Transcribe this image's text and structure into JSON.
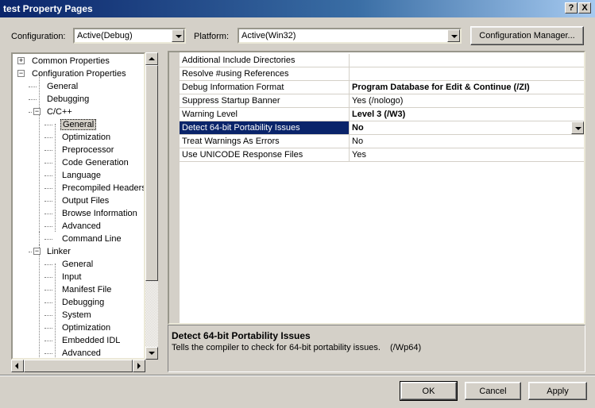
{
  "window": {
    "title": "test Property Pages",
    "help_glyph": "?",
    "close_glyph": "X"
  },
  "config": {
    "configuration_label": "Configuration:",
    "configuration_value": "Active(Debug)",
    "platform_label": "Platform:",
    "platform_value": "Active(Win32)",
    "manager_button": "Configuration Manager..."
  },
  "tree": {
    "items": [
      {
        "label": "Common Properties",
        "expander": "+"
      },
      {
        "label": "Configuration Properties",
        "expander": "−"
      },
      {
        "label": "General"
      },
      {
        "label": "Debugging"
      },
      {
        "label": "C/C++",
        "expander": "−"
      },
      {
        "label": "General",
        "selected": true
      },
      {
        "label": "Optimization"
      },
      {
        "label": "Preprocessor"
      },
      {
        "label": "Code Generation"
      },
      {
        "label": "Language"
      },
      {
        "label": "Precompiled Headers"
      },
      {
        "label": "Output Files"
      },
      {
        "label": "Browse Information"
      },
      {
        "label": "Advanced"
      },
      {
        "label": "Command Line"
      },
      {
        "label": "Linker",
        "expander": "−"
      },
      {
        "label": "General"
      },
      {
        "label": "Input"
      },
      {
        "label": "Manifest File"
      },
      {
        "label": "Debugging"
      },
      {
        "label": "System"
      },
      {
        "label": "Optimization"
      },
      {
        "label": "Embedded IDL"
      },
      {
        "label": "Advanced"
      }
    ]
  },
  "properties": {
    "rows": [
      {
        "name": "Additional Include Directories",
        "value": ""
      },
      {
        "name": "Resolve #using References",
        "value": ""
      },
      {
        "name": "Debug Information Format",
        "value": "Program Database for Edit & Continue (/ZI)",
        "bold": true
      },
      {
        "name": "Suppress Startup Banner",
        "value": "Yes (/nologo)"
      },
      {
        "name": "Warning Level",
        "value": "Level 3 (/W3)",
        "bold": true
      },
      {
        "name": "Detect 64-bit Portability Issues",
        "value": "No",
        "bold": true,
        "selected": true
      },
      {
        "name": "Treat Warnings As Errors",
        "value": "No"
      },
      {
        "name": "Use UNICODE Response Files",
        "value": "Yes"
      }
    ]
  },
  "description": {
    "title": "Detect 64-bit Portability Issues",
    "text": "Tells the compiler to check for 64-bit portability issues.",
    "flag": "(/Wp64)"
  },
  "buttons": {
    "ok": "OK",
    "cancel": "Cancel",
    "apply": "Apply"
  }
}
